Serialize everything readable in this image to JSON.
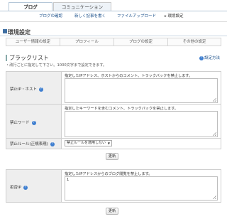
{
  "tabs": {
    "active": "ブログ",
    "inactive": "コミュニケーション"
  },
  "subnav": {
    "item1": "ブログの確認",
    "item2": "新しく記事を書く",
    "item3": "ファイルアップロード",
    "current": "▸ 環境設定"
  },
  "section": {
    "title": "環境設定"
  },
  "settings_tabs": [
    "ユーザー情報の設定",
    "プロフィール",
    "ブログの設定",
    "その他の設定"
  ],
  "blacklist": {
    "heading": "ブラックリスト",
    "help": "設定方法",
    "note": "・改行ごとに指定して下さい。1000文字まで設定できます。",
    "rows": {
      "ip_host": {
        "label": "禁止IP・ホスト",
        "desc": "指定したIPアドレス、ホストからのコメント、トラックバックを禁止します。"
      },
      "word": {
        "label": "禁止ワード",
        "desc": "指定したキーワードを含むコメント、トラックバックを禁止します。"
      },
      "regex": {
        "label": "禁止ルール(正規表現)",
        "value": "禁止ルールを適用しない"
      }
    },
    "update_button": "更新"
  },
  "deny_ip": {
    "label": "拒否IP",
    "desc": "指定したIPアドレスからのブログ閲覧を禁止します。",
    "value": "1",
    "update_button": "更新"
  }
}
